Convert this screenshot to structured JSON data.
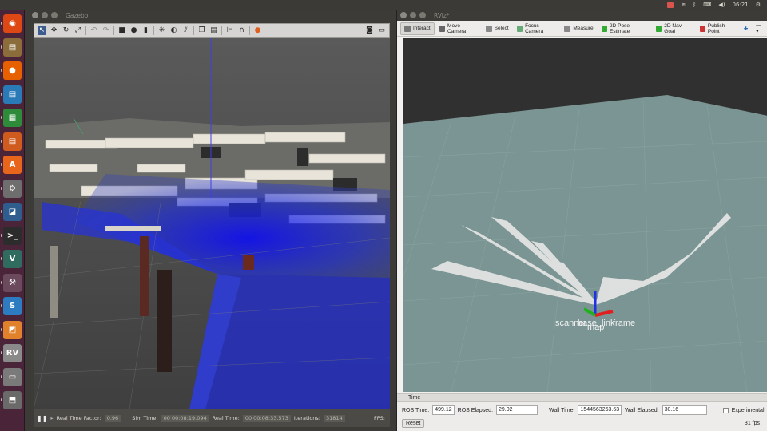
{
  "topbar": {
    "clock": "06:21"
  },
  "launcher": {
    "items": [
      {
        "name": "dash",
        "color": "#dd4814",
        "glyph": "◉"
      },
      {
        "name": "files",
        "color": "#8a6d3b",
        "glyph": "▤"
      },
      {
        "name": "firefox",
        "color": "#e66000",
        "glyph": "●"
      },
      {
        "name": "writer",
        "color": "#2a7ab8",
        "glyph": "▤"
      },
      {
        "name": "calc",
        "color": "#2e8b3a",
        "glyph": "▦"
      },
      {
        "name": "impress",
        "color": "#cf5b1e",
        "glyph": "▤"
      },
      {
        "name": "software",
        "color": "#e8651c",
        "glyph": "A"
      },
      {
        "name": "settings",
        "color": "#6e6e6e",
        "glyph": "⚙"
      },
      {
        "name": "qtcreator",
        "color": "#2e5d8e",
        "glyph": "◪"
      },
      {
        "name": "terminal",
        "color": "#2c2c2c",
        "glyph": ">_"
      },
      {
        "name": "gvim",
        "color": "#2f6b5e",
        "glyph": "V"
      },
      {
        "name": "gazebo-tool",
        "color": "#6a4a5c",
        "glyph": "⚒"
      },
      {
        "name": "update",
        "color": "#2d7cc2",
        "glyph": "S"
      },
      {
        "name": "rqt",
        "color": "#e0822c",
        "glyph": "◩"
      },
      {
        "name": "rviz",
        "color": "#8a8a8a",
        "glyph": "RV"
      },
      {
        "name": "workspace",
        "color": "#7a7a7a",
        "glyph": "▭"
      },
      {
        "name": "trash",
        "color": "#6a6a6a",
        "glyph": "⬒"
      }
    ]
  },
  "gazebo": {
    "title": "Gazebo",
    "status": {
      "real_time_factor_label": "Real Time Factor:",
      "real_time_factor": "0.96",
      "sim_time_label": "Sim Time:",
      "sim_time": "00 00:08:19.094",
      "real_time_label": "Real Time:",
      "real_time": "00 00:08:33.573",
      "iterations_label": "Iterations:",
      "iterations": "31814",
      "fps_label": "FPS:"
    }
  },
  "rviz": {
    "title": "RViz*",
    "tools": [
      {
        "label": "Interact",
        "icon": "pointer-icon",
        "active": true
      },
      {
        "label": "Move Camera",
        "icon": "move-icon",
        "active": false
      },
      {
        "label": "Select",
        "icon": "select-icon",
        "active": false
      },
      {
        "label": "Focus Camera",
        "icon": "focus-icon",
        "active": false
      },
      {
        "label": "Measure",
        "icon": "ruler-icon",
        "active": false
      },
      {
        "label": "2D Pose Estimate",
        "icon": "pose-arrow-icon",
        "active": false
      },
      {
        "label": "2D Nav Goal",
        "icon": "goal-arrow-icon",
        "active": false
      },
      {
        "label": "Publish Point",
        "icon": "pin-icon",
        "active": false
      }
    ],
    "frame_labels": {
      "scan": "scanner",
      "base": "base_link",
      "frame": "frame",
      "map": "map"
    },
    "time_panel": {
      "header": "Time",
      "ros_time_label": "ROS Time:",
      "ros_time": "499.12",
      "ros_elapsed_label": "ROS Elapsed:",
      "ros_elapsed": "29.02",
      "wall_time_label": "Wall Time:",
      "wall_time": "1544563263.63",
      "wall_elapsed_label": "Wall Elapsed:",
      "wall_elapsed": "30.16",
      "experimental_label": "Experimental",
      "reset_label": "Reset",
      "fps": "31 fps"
    }
  }
}
